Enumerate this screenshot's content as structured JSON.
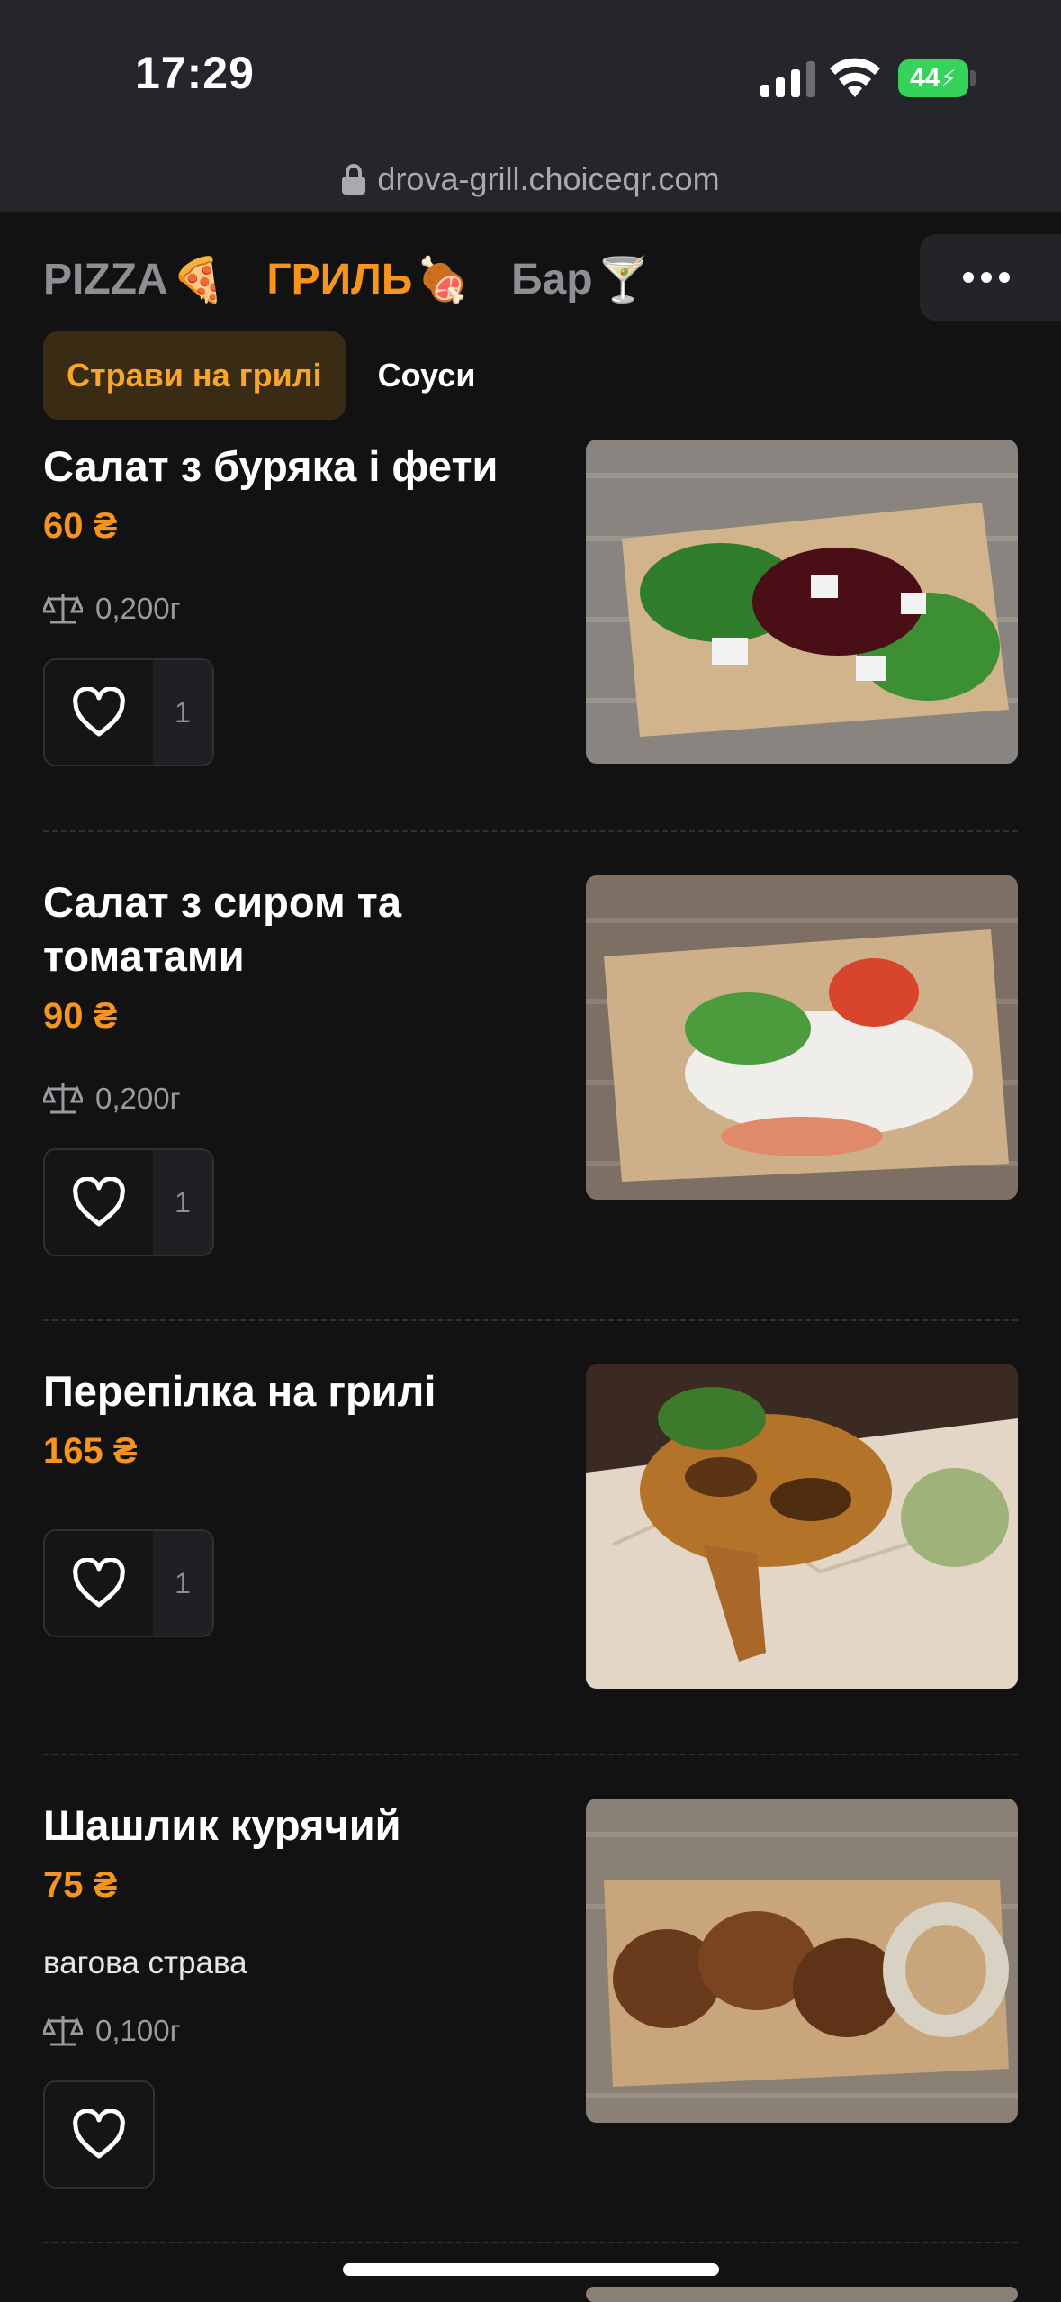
{
  "status_bar": {
    "time": "17:29",
    "battery": "44",
    "url": "drova-grill.choiceqr.com"
  },
  "categories": [
    {
      "label": "PIZZA",
      "emoji": "🍕",
      "active": false
    },
    {
      "label": "ГРИЛЬ",
      "emoji": "🍖",
      "active": true
    },
    {
      "label": "Бар",
      "emoji": "🍸",
      "active": false
    }
  ],
  "subcategories": [
    {
      "label": "Страви на грилі",
      "active": true
    },
    {
      "label": "Соуси",
      "active": false
    }
  ],
  "items": [
    {
      "title": "Салат з буряка і фети",
      "price": "60 ₴",
      "weight": "0,200г",
      "fav_count": "1"
    },
    {
      "title": "Салат з сиром та томатами",
      "price": "90 ₴",
      "weight": "0,200г",
      "fav_count": "1"
    },
    {
      "title": "Перепілка на грилі",
      "price": "165 ₴",
      "fav_count": "1"
    },
    {
      "title": "Шашлик курячий",
      "price": "75 ₴",
      "description": "вагова страва",
      "weight": "0,100г"
    }
  ],
  "colors": {
    "accent": "#f7941d",
    "background": "#121212",
    "topbar": "#25262b"
  },
  "icons": [
    "lock-icon",
    "more-icon",
    "scale-icon",
    "heart-icon",
    "signal-icon",
    "wifi-icon",
    "battery-icon"
  ]
}
